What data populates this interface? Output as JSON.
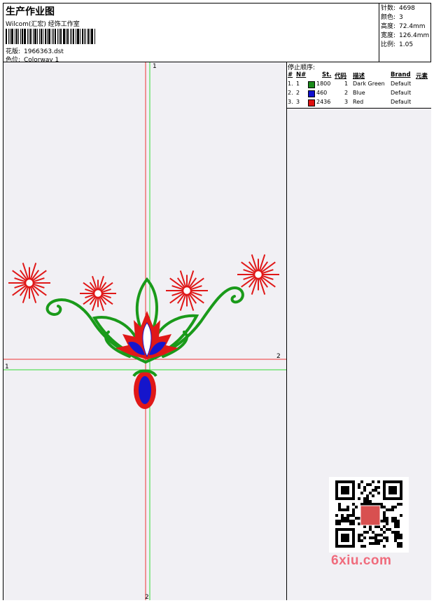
{
  "header": {
    "title": "生产作业图",
    "company": "Wilcom(汇宏) 经饰工作室",
    "design_label": "花版:",
    "design_value": "1966363.dst",
    "colorway_label": "色位:",
    "colorway_value": "Colorway 1"
  },
  "stats": [
    {
      "label": "针数:",
      "value": "4698"
    },
    {
      "label": "颜色:",
      "value": "3"
    },
    {
      "label": "高度:",
      "value": "72.4mm"
    },
    {
      "label": "宽度:",
      "value": "126.4mm"
    },
    {
      "label": "比例:",
      "value": "1.05"
    }
  ],
  "stop_sequence": {
    "title": "停止顺序:",
    "columns": [
      "#",
      "N#",
      "St.",
      "代码",
      "描述",
      "Brand",
      "元素"
    ],
    "rows": [
      {
        "idx": "1.",
        "n": "1",
        "color": "#1a8a1a",
        "stitches": "1800",
        "code": "1",
        "desc": "Dark Green",
        "brand": "Default"
      },
      {
        "idx": "2.",
        "n": "2",
        "color": "#1010d0",
        "stitches": "460",
        "code": "2",
        "desc": "Blue",
        "brand": "Default"
      },
      {
        "idx": "3.",
        "n": "3",
        "color": "#e01010",
        "stitches": "2436",
        "code": "3",
        "desc": "Red",
        "brand": "Default"
      }
    ]
  },
  "canvas": {
    "marker_v_top": "1",
    "marker_v_bottom": "2",
    "marker_h_left": "1",
    "marker_h_right": "2",
    "colors": {
      "green": "#1a9a1a",
      "blue": "#1515cc",
      "red": "#e01818",
      "axis_green": "#33dd33",
      "axis_red": "#ee3333"
    }
  },
  "watermark": "6xiu.com",
  "qr_stamp": "汉风图库"
}
